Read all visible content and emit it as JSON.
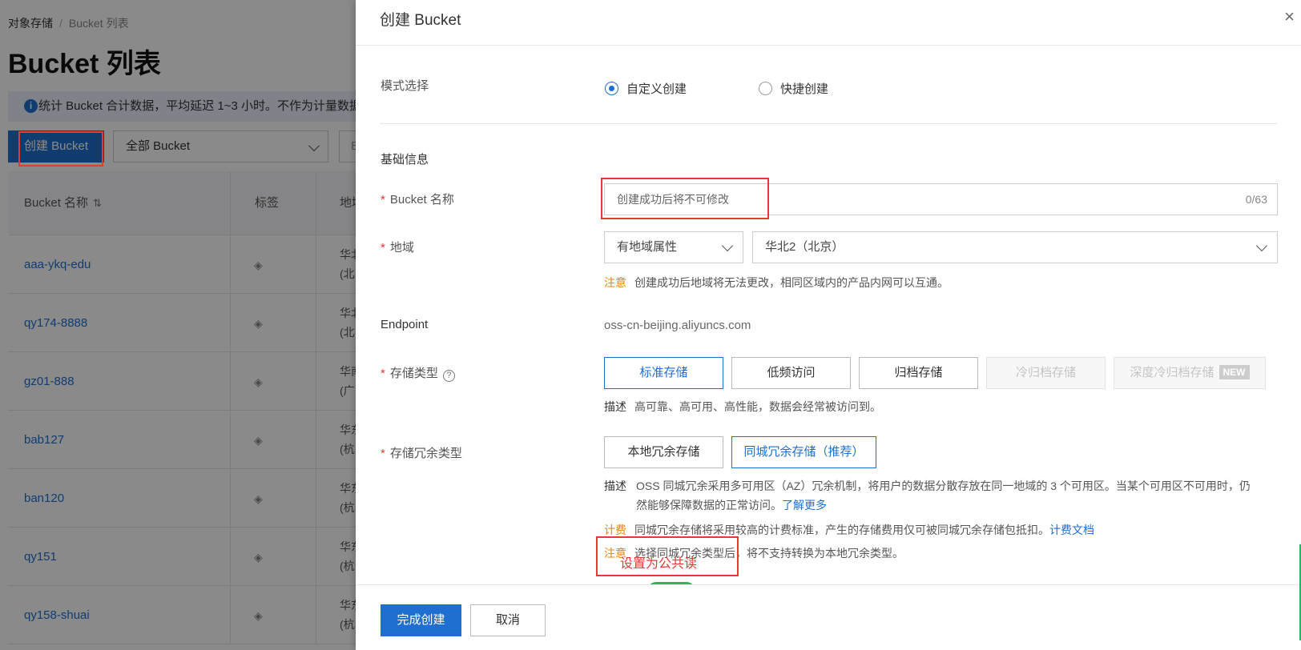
{
  "background": {
    "breadcrumb": {
      "root": "对象存储",
      "sep": "/",
      "current": "Bucket 列表"
    },
    "title": "Bucket 列表",
    "info_text": "统计 Bucket 合计数据，平均延迟 1~3 小时。不作为计量数据",
    "info_icon": "info-icon",
    "create_button": "创建 Bucket",
    "filter_select": "全部 Bucket",
    "filter_more": "B",
    "table": {
      "headers": {
        "name": "Bucket 名称",
        "tags": "标签",
        "region": "地域"
      },
      "rows": [
        {
          "name": "aaa-ykq-edu",
          "region1": "华北",
          "region2": "(北"
        },
        {
          "name": "qy174-8888",
          "region1": "华北",
          "region2": "(北"
        },
        {
          "name": "gz01-888",
          "region1": "华南",
          "region2": "(广"
        },
        {
          "name": "bab127",
          "region1": "华东",
          "region2": "(杭"
        },
        {
          "name": "ban120",
          "region1": "华东",
          "region2": "(杭"
        },
        {
          "name": "qy151",
          "region1": "华东",
          "region2": "(杭"
        },
        {
          "name": "qy158-shuai",
          "region1": "华东",
          "region2": "(杭"
        }
      ]
    }
  },
  "drawer": {
    "title": "创建 Bucket",
    "close_icon": "×",
    "mode": {
      "label": "模式选择",
      "options": [
        "自定义创建",
        "快捷创建"
      ],
      "selected": "自定义创建"
    },
    "section_basic": "基础信息",
    "bucket_name": {
      "label": "Bucket 名称",
      "placeholder": "创建成功后将不可修改",
      "counter": "0/63"
    },
    "region": {
      "label": "地域",
      "type_select": "有地域属性",
      "region_select": "华北2（北京）",
      "note_key": "注意",
      "note_text": "创建成功后地域将无法更改，相同区域内的产品内网可以互通。"
    },
    "endpoint": {
      "label": "Endpoint",
      "value": "oss-cn-beijing.aliyuncs.com"
    },
    "storage_class": {
      "label": "存储类型",
      "help_icon": "?",
      "options": [
        "标准存储",
        "低频访问",
        "归档存储",
        "冷归档存储",
        "深度冷归档存储"
      ],
      "selected": "标准存储",
      "new_badge": "NEW",
      "desc_key": "描述",
      "desc_text": "高可靠、高可用、高性能，数据会经常被访问到。"
    },
    "redundancy": {
      "label": "存储冗余类型",
      "options": [
        "本地冗余存储",
        "同城冗余存储（推荐）"
      ],
      "selected": "同城冗余存储（推荐）",
      "desc_key": "描述",
      "desc_text": "OSS 同城冗余采用多可用区（AZ）冗余机制，将用户的数据分散存放在同一地域的 3 个可用区。当某个可用区不可用时，仍然能够保障数据的正常访问。",
      "learn_more": "了解更多",
      "fee_key": "计费",
      "fee_text": "同城冗余存储将采用较高的计费标准，产生的存储费用仅可被同城冗余存储包抵扣。",
      "fee_link": "计费文档",
      "note_key": "注意",
      "note_text": "选择同城冗余类型后，将不支持转换为本地冗余类型。"
    },
    "annotation_text": "设置为公共读",
    "footer": {
      "confirm": "完成创建",
      "cancel": "取消"
    }
  },
  "colors": {
    "primary": "#1f6fd0",
    "warning": "#e8850c",
    "annotation": "#e53935",
    "toggle": "#2db55d"
  }
}
